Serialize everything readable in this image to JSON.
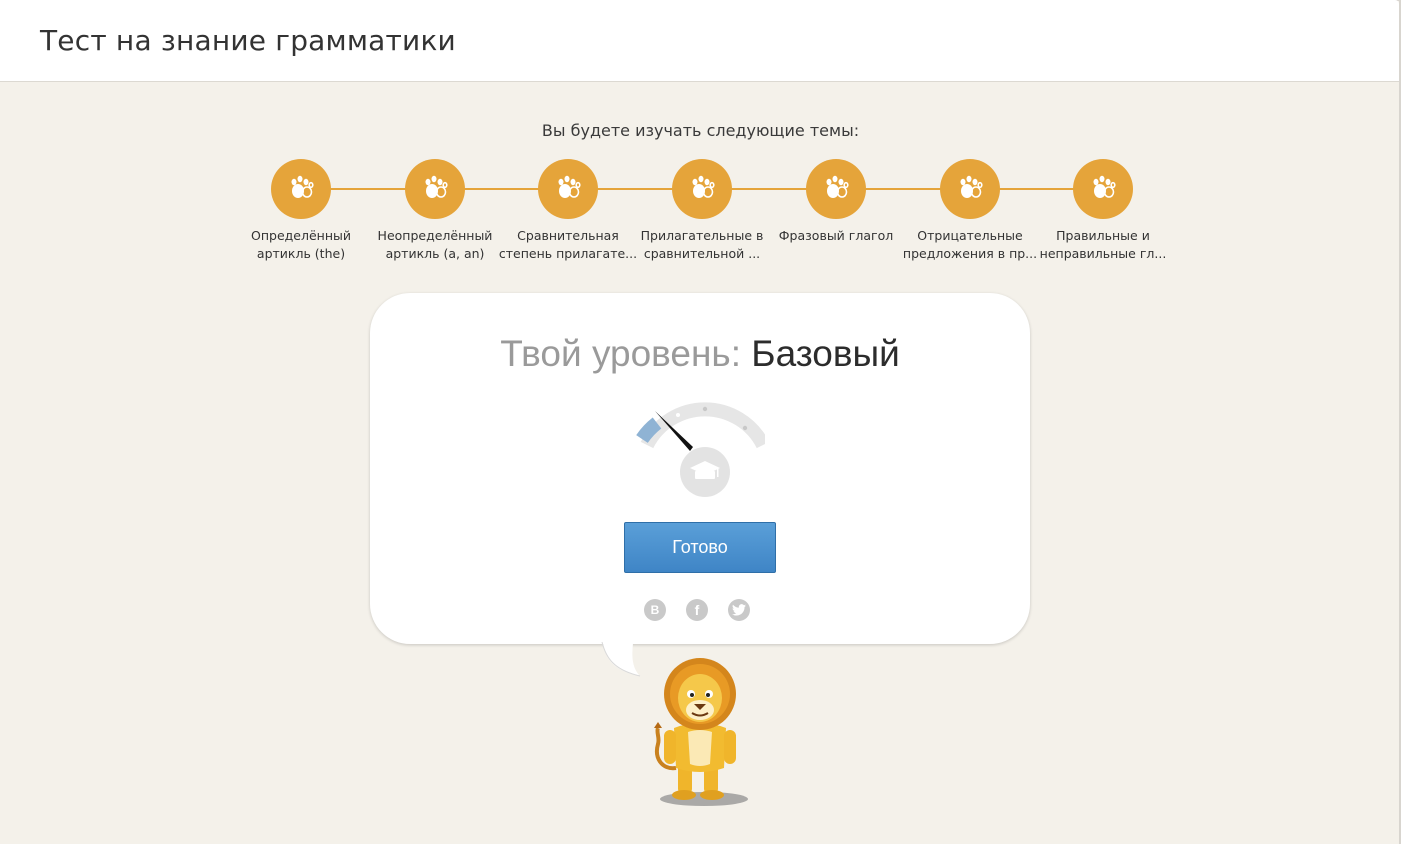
{
  "header": {
    "title": "Тест на знание грамматики"
  },
  "topics": {
    "caption": "Вы будете изучать следующие темы:",
    "items": [
      {
        "label": "Определённый артикль (the)",
        "icon": "paw-icon"
      },
      {
        "label": "Неопределённый артикль (a, an)",
        "icon": "paw-icon"
      },
      {
        "label": "Сравнительная степень прилагате...",
        "icon": "paw-icon"
      },
      {
        "label": "Прилагательные в сравнительной ...",
        "icon": "paw-icon"
      },
      {
        "label": "Фразовый глагол",
        "icon": "paw-icon"
      },
      {
        "label": "Отрицательные предложения в пр...",
        "icon": "paw-icon"
      },
      {
        "label": "Правильные и неправильные гл...",
        "icon": "paw-icon"
      }
    ]
  },
  "result": {
    "level_prefix": "Твой уровень:",
    "level_value": "Базовый",
    "gauge_level": "1 of 4",
    "ready_label": "Готово"
  },
  "social": [
    {
      "name": "vk-icon",
      "glyph": "B"
    },
    {
      "name": "facebook-icon",
      "glyph": "f"
    },
    {
      "name": "twitter-icon",
      "glyph": "t"
    }
  ],
  "colors": {
    "accent": "#e5a43a",
    "button": "#4a90d0",
    "background": "#f4f1ea"
  }
}
